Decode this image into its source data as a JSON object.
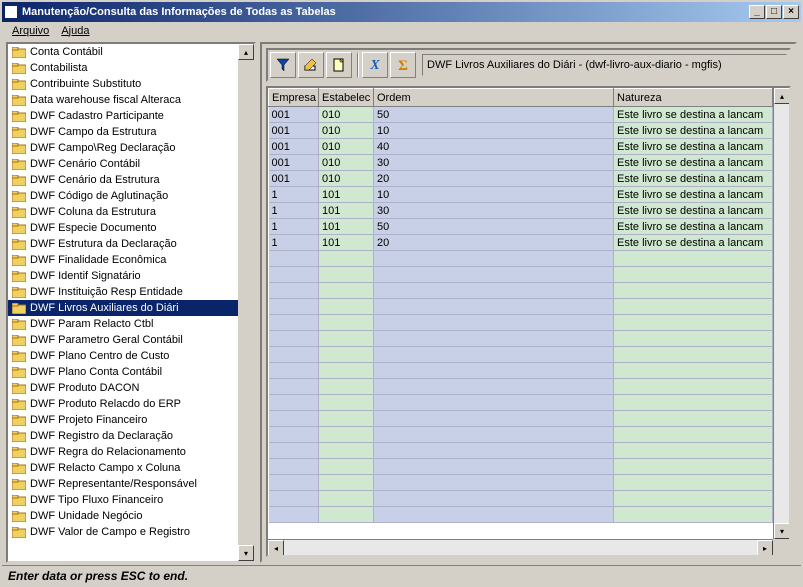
{
  "window": {
    "title": "Manutenção/Consulta das Informações de Todas as Tabelas"
  },
  "menubar": {
    "file": "Arquivo",
    "help": "Ajuda"
  },
  "tree": {
    "items": [
      {
        "label": "Conta Contábil"
      },
      {
        "label": "Contabilista"
      },
      {
        "label": "Contribuinte Substituto"
      },
      {
        "label": "Data warehouse fiscal Alteraca"
      },
      {
        "label": "DWF Cadastro Participante"
      },
      {
        "label": "DWF Campo da Estrutura"
      },
      {
        "label": "DWF Campo\\Reg Declaração"
      },
      {
        "label": "DWF Cenário Contábil"
      },
      {
        "label": "DWF Cenário da Estrutura"
      },
      {
        "label": "DWF Código de Aglutinação"
      },
      {
        "label": "DWF Coluna da Estrutura"
      },
      {
        "label": "DWF Especie Documento"
      },
      {
        "label": "DWF Estrutura da Declaração"
      },
      {
        "label": "DWF Finalidade Econômica"
      },
      {
        "label": "DWF Identif Signatário"
      },
      {
        "label": "DWF Instituição Resp Entidade"
      },
      {
        "label": "DWF Livros Auxiliares do Diári",
        "selected": true
      },
      {
        "label": "DWF Param Relacto Ctbl"
      },
      {
        "label": "DWF Parametro Geral Contábil"
      },
      {
        "label": "DWF Plano Centro de Custo"
      },
      {
        "label": "DWF Plano Conta Contábil"
      },
      {
        "label": "DWF Produto DACON"
      },
      {
        "label": "DWF Produto Relacdo do ERP"
      },
      {
        "label": "DWF Projeto Financeiro"
      },
      {
        "label": "DWF Registro da Declaração"
      },
      {
        "label": "DWF Regra do Relacionamento"
      },
      {
        "label": "DWF Relacto Campo x Coluna"
      },
      {
        "label": "DWF Representante/Responsável"
      },
      {
        "label": "DWF Tipo Fluxo Financeiro"
      },
      {
        "label": "DWF Unidade Negócio"
      },
      {
        "label": "DWF Valor de Campo e Registro"
      }
    ]
  },
  "toolbar": {
    "path": "DWF Livros Auxiliares do Diári - (dwf-livro-aux-diario - mgfis)"
  },
  "grid": {
    "columns": [
      "Empresa",
      "Estabelec",
      "Ordem",
      "Natureza"
    ],
    "rows": [
      {
        "empresa": "001",
        "estab": "010",
        "ordem": "50",
        "natureza": "Este livro se destina a lancam"
      },
      {
        "empresa": "001",
        "estab": "010",
        "ordem": "10",
        "natureza": "Este livro se destina a lancam"
      },
      {
        "empresa": "001",
        "estab": "010",
        "ordem": "40",
        "natureza": "Este livro se destina a lancam"
      },
      {
        "empresa": "001",
        "estab": "010",
        "ordem": "30",
        "natureza": "Este livro se destina a lancam"
      },
      {
        "empresa": "001",
        "estab": "010",
        "ordem": "20",
        "natureza": "Este livro se destina a lancam"
      },
      {
        "empresa": "1",
        "estab": "101",
        "ordem": "10",
        "natureza": "Este livro se destina a lancam"
      },
      {
        "empresa": "1",
        "estab": "101",
        "ordem": "30",
        "natureza": "Este livro se destina a lancam"
      },
      {
        "empresa": "1",
        "estab": "101",
        "ordem": "50",
        "natureza": "Este livro se destina a lancam"
      },
      {
        "empresa": "1",
        "estab": "101",
        "ordem": "20",
        "natureza": "Este livro se destina a lancam"
      }
    ],
    "empty_row_count": 17
  },
  "statusbar": {
    "text": "Enter data or press ESC to end."
  },
  "icons": {
    "filter": "filter-icon",
    "edit": "edit-icon",
    "new": "new-icon",
    "excel": "excel-icon",
    "sum": "sum-icon"
  }
}
